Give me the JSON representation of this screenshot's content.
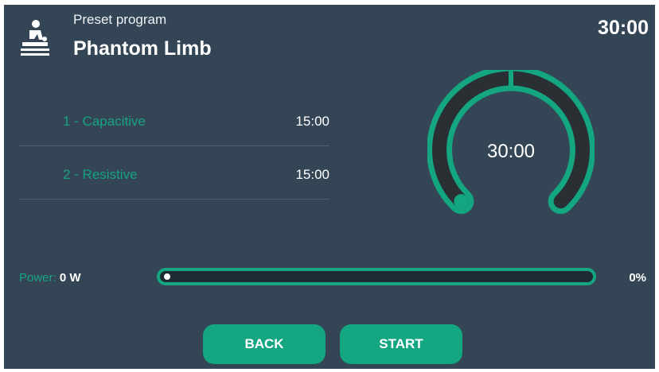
{
  "header": {
    "icon": "massage-therapy-icon",
    "subtitle": "Preset program",
    "title": "Phantom Limb",
    "total_time": "30:00"
  },
  "steps": [
    {
      "label": "1 - Capacitive",
      "time": "15:00"
    },
    {
      "label": "2 - Resistive",
      "time": "15:00"
    }
  ],
  "dial": {
    "value": "30:00",
    "progress": 0
  },
  "power": {
    "label": "Power:",
    "value": "0 W",
    "percent_text": "0%",
    "level": 0
  },
  "buttons": {
    "back": "BACK",
    "start": "START"
  },
  "colors": {
    "background": "#344656",
    "accent": "#13a681",
    "label_green": "#18a37f",
    "track": "#1e2b33"
  }
}
